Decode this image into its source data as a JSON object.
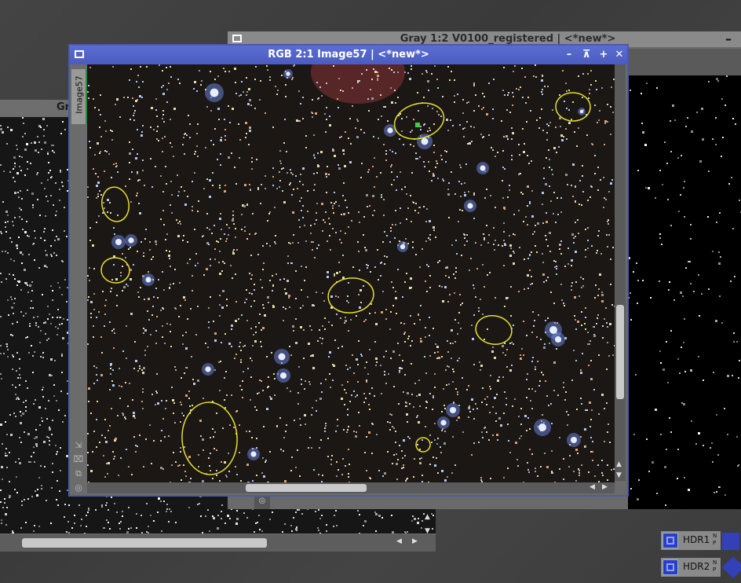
{
  "windows": {
    "left": {
      "title": "Gr"
    },
    "gray": {
      "title": "Gray 1:2 V0100_registered | <*new*>",
      "minimize": "–"
    },
    "rgb": {
      "title": "RGB 2:1 Image57 | <*new*>",
      "side_tab": "Image57",
      "buttons": {
        "shade": "–",
        "maximize": "⊼",
        "restore": "+",
        "close": "✕"
      }
    }
  },
  "docks": [
    {
      "label": "HDR1",
      "np": "N\nP"
    },
    {
      "label": "HDR2",
      "np": "N\nP"
    }
  ],
  "annotations": {
    "ellipse_color": "#e8e02a",
    "count": 9
  },
  "colors": {
    "active_title": "#5b6dd0",
    "workspace": "#3d3d3d",
    "star_blue": "#9fb6ff"
  },
  "icons": [
    "window-sys-icon",
    "cursor-crosshair-icon",
    "zoom-fit-icon",
    "lock-icon",
    "copy-icon",
    "target-icon"
  ]
}
